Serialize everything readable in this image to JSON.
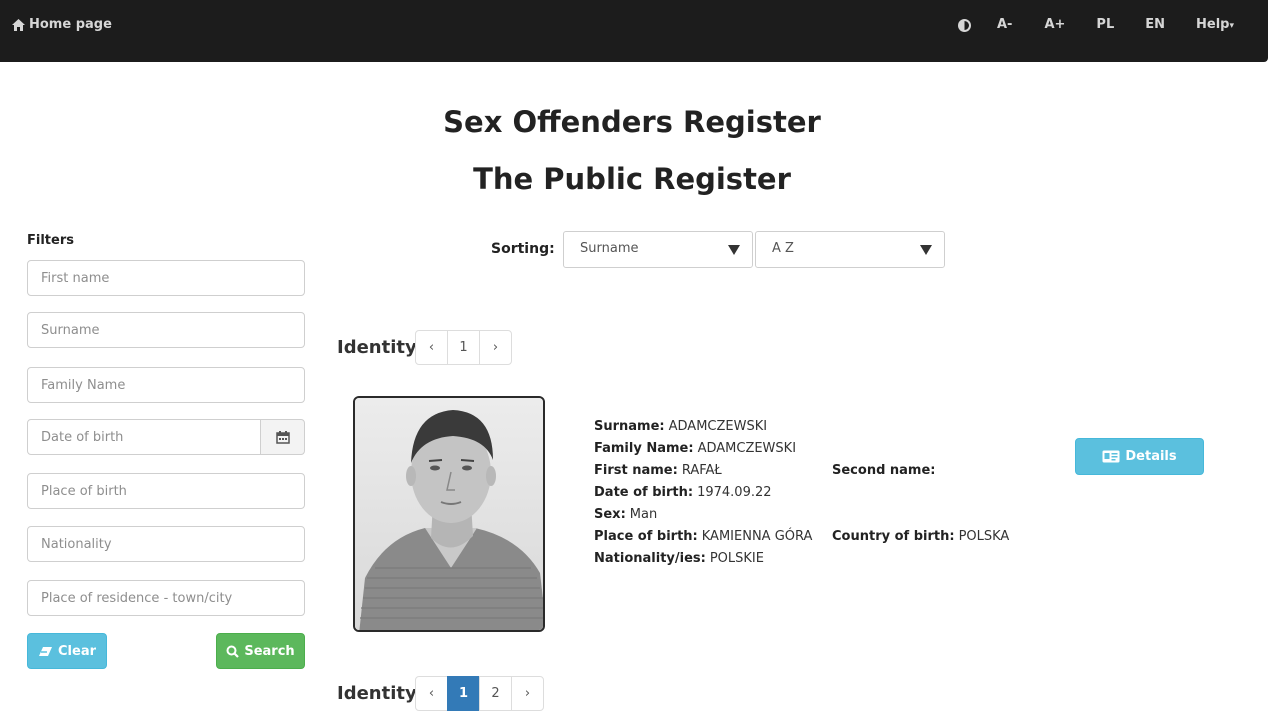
{
  "nav": {
    "home": "Home page",
    "decrease_font": "A-",
    "increase_font": "A+",
    "lang_pl": "PL",
    "lang_en": "EN",
    "help": "Help"
  },
  "title": "Sex Offenders Register",
  "subtitle": "The Public Register",
  "filters": {
    "label": "Filters",
    "first_name_placeholder": "First name",
    "surname_placeholder": "Surname",
    "family_name_placeholder": "Family Name",
    "date_of_birth_placeholder": "Date of birth",
    "place_of_birth_placeholder": "Place of birth",
    "nationality_placeholder": "Nationality",
    "residence_placeholder": "Place of residence - town/city",
    "clear_label": "Clear",
    "search_label": "Search"
  },
  "sorting": {
    "label": "Sorting:",
    "field": "Surname",
    "order": "A Z"
  },
  "identity_label": "Identity:",
  "pager_top": {
    "prev": "‹",
    "pages": [
      "1"
    ],
    "next": "›"
  },
  "pager_bottom": {
    "prev": "‹",
    "pages": [
      "1",
      "2"
    ],
    "active": "1",
    "next": "›"
  },
  "record": {
    "surname_label": "Surname:",
    "surname": "ADAMCZEWSKI",
    "family_name_label": "Family Name:",
    "family_name": "ADAMCZEWSKI",
    "first_name_label": "First name:",
    "first_name": "RAFAŁ",
    "second_name_label": "Second name:",
    "second_name": "",
    "dob_label": "Date of birth:",
    "dob": "1974.09.22",
    "sex_label": "Sex:",
    "sex": "Man",
    "pob_label": "Place of birth:",
    "pob": "KAMIENNA GÓRA",
    "cob_label": "Country of birth:",
    "cob": "POLSKA",
    "nationality_label": "Nationality/ies:",
    "nationality": "POLSKIE",
    "details_label": "Details"
  },
  "colors": {
    "info": "#5bc0de",
    "success": "#5cb85c",
    "primary": "#337ab7",
    "navbar": "#1c1c1c"
  }
}
